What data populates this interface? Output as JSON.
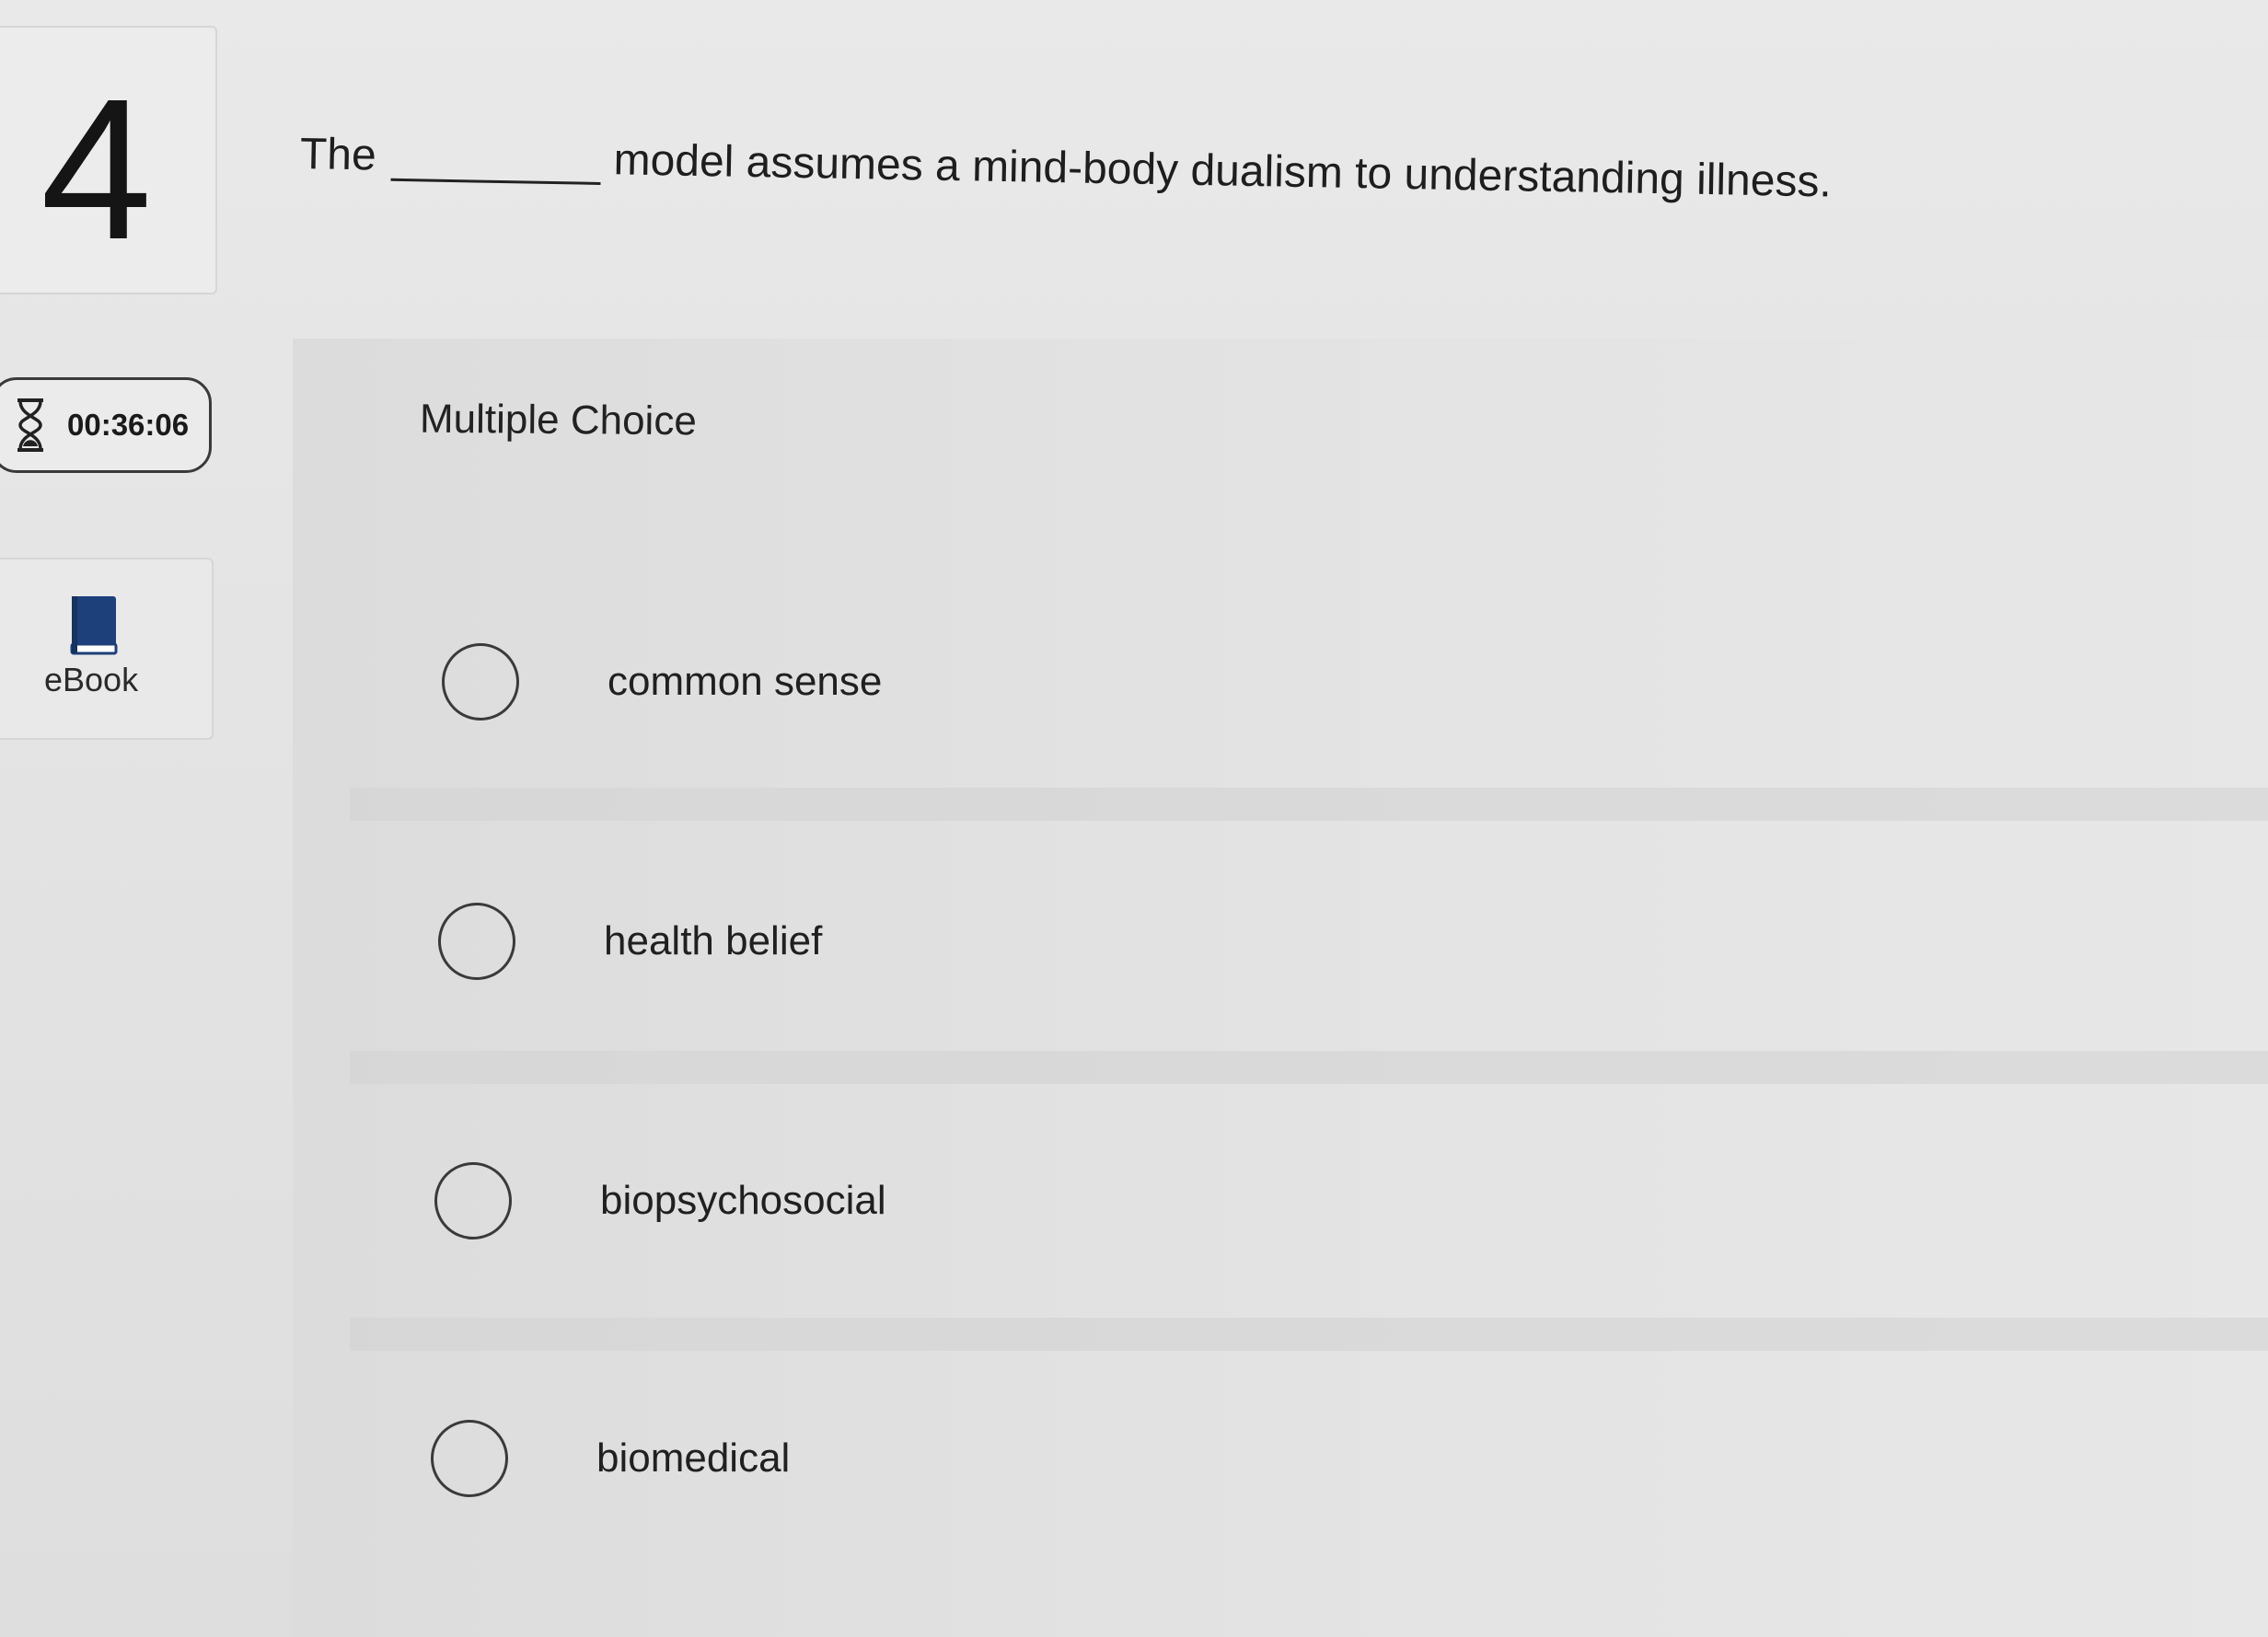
{
  "question_number": "4",
  "timer": {
    "value": "00:36:06",
    "icon": "hourglass-icon"
  },
  "ebook": {
    "label": "eBook",
    "icon": "book-icon",
    "icon_color": "#1d3f7a"
  },
  "question": {
    "prefix": "The",
    "suffix": "model assumes a mind-body dualism to understanding illness."
  },
  "answer_type": "Multiple Choice",
  "options": [
    {
      "label": "common sense",
      "selected": false
    },
    {
      "label": "health belief",
      "selected": false
    },
    {
      "label": "biopsychosocial",
      "selected": false
    },
    {
      "label": "biomedical",
      "selected": false
    }
  ]
}
